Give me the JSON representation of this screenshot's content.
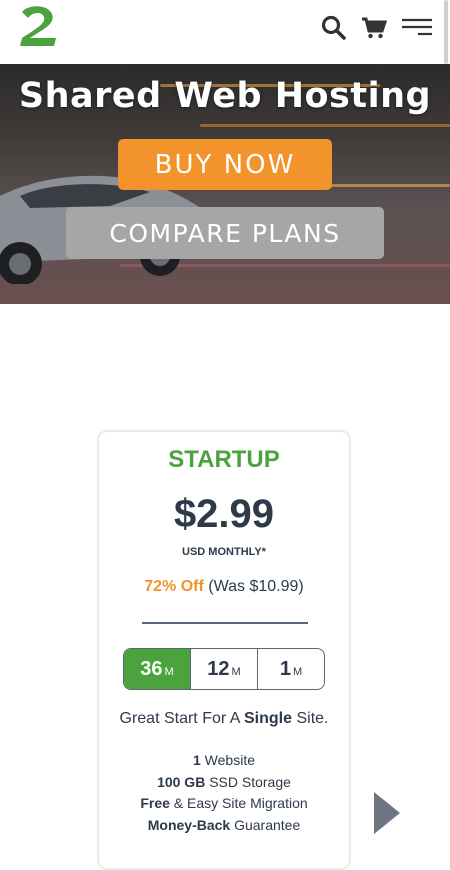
{
  "header": {
    "logo_icon": "a2-logo-icon",
    "search_icon": "search-icon",
    "cart_icon": "cart-icon",
    "menu_icon": "menu-icon"
  },
  "hero": {
    "title": "Shared Web Hosting",
    "buy_label": "BUY NOW",
    "compare_label": "COMPARE PLANS",
    "colors": {
      "buy": "#f2932b",
      "compare": "#a6a6a6"
    }
  },
  "plan": {
    "name": "STARTUP",
    "price": "$2.99",
    "price_note": "USD MONTHLY*",
    "discount_off": "72% Off",
    "discount_was": "(Was $10.99)",
    "terms": [
      {
        "num": "36",
        "unit": "M",
        "active": true
      },
      {
        "num": "12",
        "unit": "M",
        "active": false
      },
      {
        "num": "1",
        "unit": "M",
        "active": false
      }
    ],
    "tagline_pre": "Great Start For A ",
    "tagline_bold": "Single",
    "tagline_post": " Site.",
    "features": [
      {
        "bold": "1",
        "text": " Website",
        "bold_first": true
      },
      {
        "bold": "100 GB",
        "text": " SSD Storage",
        "bold_first": true
      },
      {
        "bold": "Free",
        "text": " & Easy Site Migration",
        "bold_first": true
      },
      {
        "bold": "Money-Back",
        "text": " Guarantee",
        "bold_first": true
      }
    ],
    "colors": {
      "accent": "#4aa33c",
      "orange": "#f2932b",
      "text": "#2e3a4a"
    }
  },
  "carousel": {
    "next_icon": "chevron-right-icon"
  }
}
